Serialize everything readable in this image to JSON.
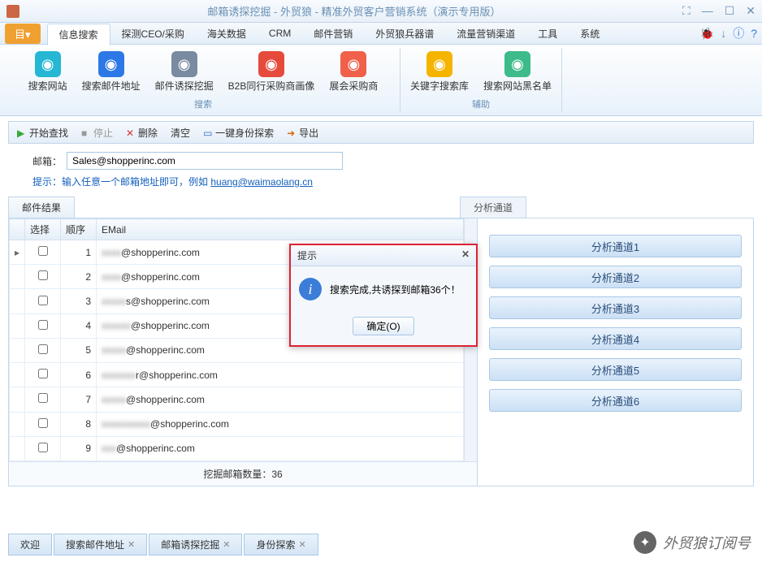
{
  "app": {
    "title": "邮箱诱探挖掘 - 外贸狼 - 精准外贸客户营销系统（演示专用版）"
  },
  "menu": {
    "file": "目▾",
    "items": [
      "信息搜索",
      "探测CEO/采购",
      "海关数据",
      "CRM",
      "邮件营销",
      "外贸狼兵器谱",
      "流量营销渠道",
      "工具",
      "系统"
    ]
  },
  "ribbon": {
    "group1": {
      "title": "搜索",
      "items": [
        {
          "label": "搜索网站",
          "color": "#25b7d3"
        },
        {
          "label": "搜索邮件地址",
          "color": "#2d78e6"
        },
        {
          "label": "邮件诱探挖掘",
          "color": "#7a8aa0"
        },
        {
          "label": "B2B同行采购商画像",
          "color": "#e64a3b"
        },
        {
          "label": "展会采购商",
          "color": "#f0604a"
        }
      ]
    },
    "group2": {
      "title": "辅助",
      "items": [
        {
          "label": "关键字搜索库",
          "color": "#f5b400"
        },
        {
          "label": "搜索网站黑名单",
          "color": "#3dbb8a"
        }
      ]
    }
  },
  "toolbar": {
    "start": "开始查找",
    "stop": "停止",
    "delete": "删除",
    "clear": "清空",
    "one_click": "一键身份探索",
    "export": "导出"
  },
  "input": {
    "label": "邮箱：",
    "value": "Sales@shopperinc.com",
    "hint_prefix": "提示：输入任意一个邮箱地址即可，例如 ",
    "hint_link": "huang@waimaolang.cn"
  },
  "tabs": {
    "results": "邮件结果",
    "analysis": "分析通道"
  },
  "table": {
    "headers": {
      "select": "选择",
      "order": "顺序",
      "email": "EMail"
    },
    "rows": [
      {
        "n": 1,
        "mask": "xxxx",
        "tail": "@shopperinc.com"
      },
      {
        "n": 2,
        "mask": "xxxx",
        "tail": "@shopperinc.com"
      },
      {
        "n": 3,
        "mask": "xxxxx",
        "tail": "s@shopperinc.com"
      },
      {
        "n": 4,
        "mask": "xxxxxx",
        "tail": "@shopperinc.com"
      },
      {
        "n": 5,
        "mask": "xxxxx",
        "tail": "@shopperinc.com"
      },
      {
        "n": 6,
        "mask": "xxxxxxx",
        "tail": "r@shopperinc.com"
      },
      {
        "n": 7,
        "mask": "xxxxx",
        "tail": "@shopperinc.com"
      },
      {
        "n": 8,
        "mask": "xxxxxxxxxx",
        "tail": "@shopperinc.com"
      },
      {
        "n": 9,
        "mask": "xxx",
        "tail": "@shopperinc.com"
      }
    ],
    "summary": "挖掘邮箱数量：36"
  },
  "channels": [
    "分析通道1",
    "分析通道2",
    "分析通道3",
    "分析通道4",
    "分析通道5",
    "分析通道6"
  ],
  "dialog": {
    "title": "提示",
    "message": "搜索完成,共诱探到邮箱36个！",
    "ok": "确定(O)"
  },
  "bottom_tabs": [
    "欢迎",
    "搜索邮件地址",
    "邮箱诱探挖掘",
    "身份探索"
  ],
  "watermark": "外贸狼订阅号"
}
